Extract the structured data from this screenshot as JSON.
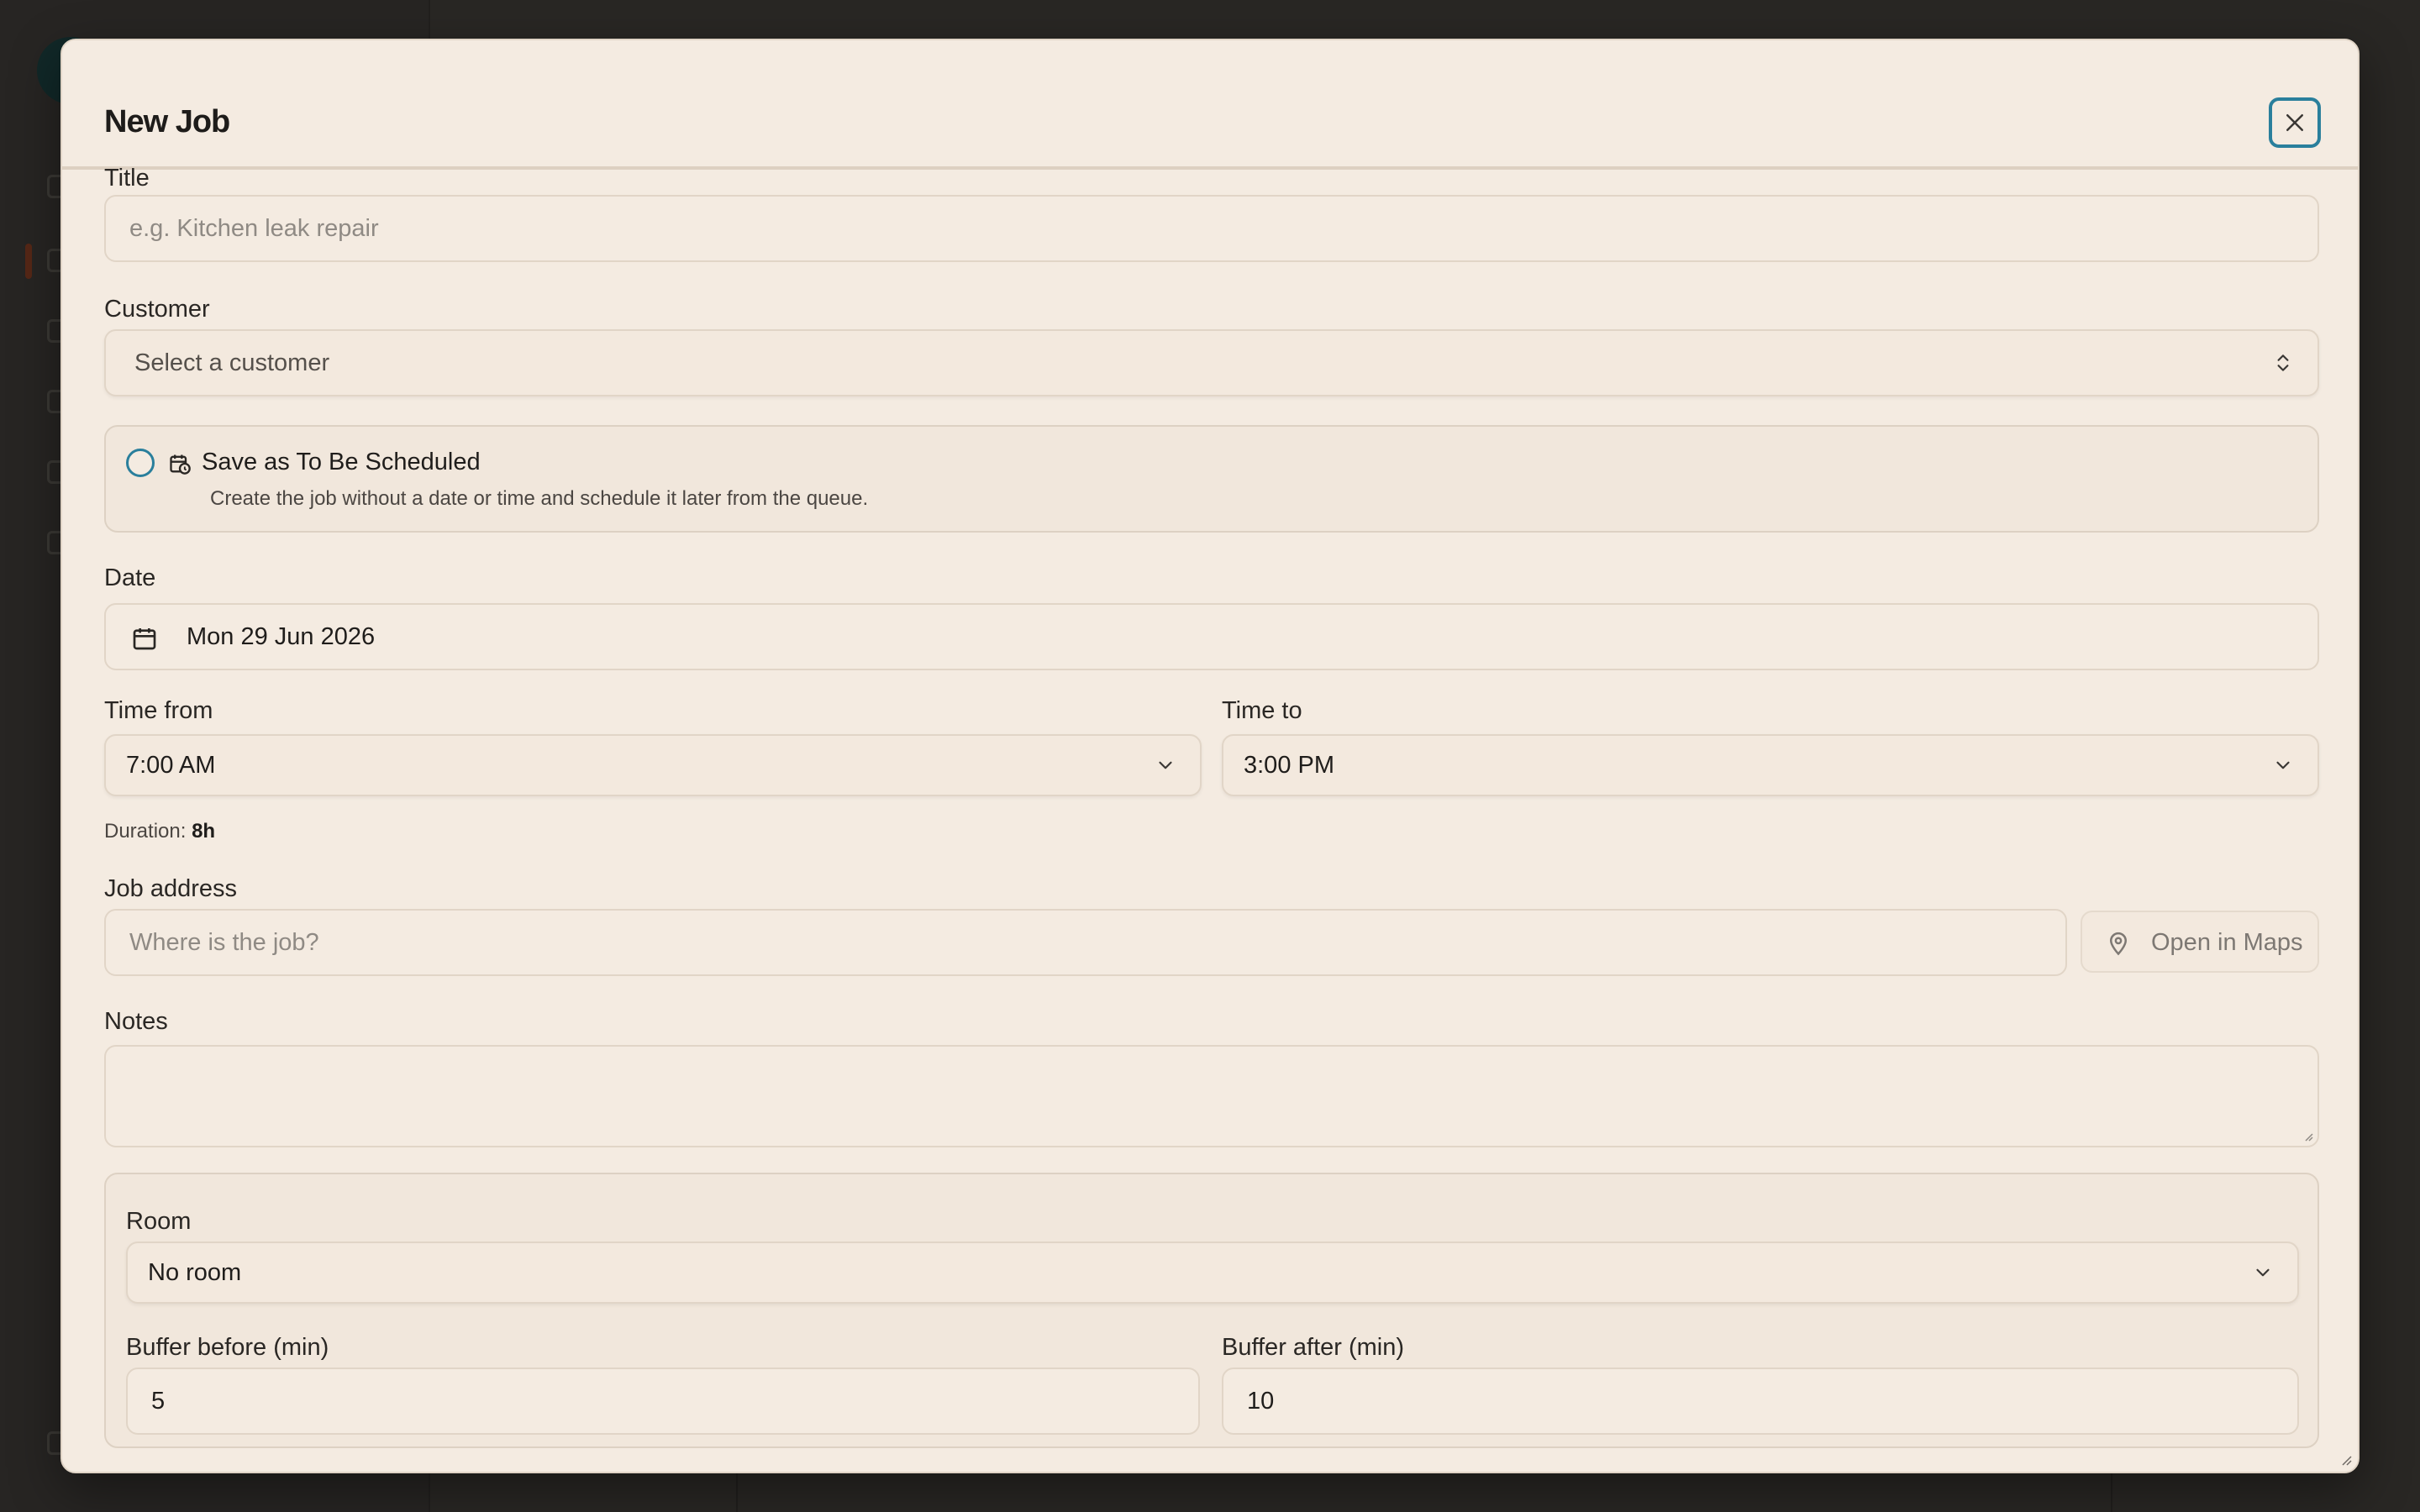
{
  "modal": {
    "title": "New Job",
    "close_icon": "close-icon"
  },
  "fields": {
    "title_label": "Title",
    "title_placeholder": "e.g. Kitchen leak repair",
    "customer_label": "Customer",
    "customer_value": "Select a customer",
    "schedule": {
      "title": "Save as To Be Scheduled",
      "description": "Create the job without a date or time and schedule it later from the queue.",
      "checked": false
    },
    "date_label": "Date",
    "date_value": "Mon 29 Jun 2026",
    "time_from_label": "Time from",
    "time_from_value": "7:00 AM",
    "time_to_label": "Time to",
    "time_to_value": "3:00 PM",
    "duration_label": "Duration:",
    "duration_value": "8h",
    "address_label": "Job address",
    "address_placeholder": "Where is the job?",
    "open_maps_label": "Open in Maps",
    "notes_label": "Notes",
    "notes_value": "",
    "room_label": "Room",
    "room_value": "No room",
    "buffer_before_label": "Buffer before (min)",
    "buffer_before_value": "5",
    "buffer_after_label": "Buffer after (min)",
    "buffer_after_value": "10"
  },
  "colors": {
    "accent": "#2a7f9c",
    "modal_bg": "#f4ebe1",
    "overlay": "#343230"
  }
}
